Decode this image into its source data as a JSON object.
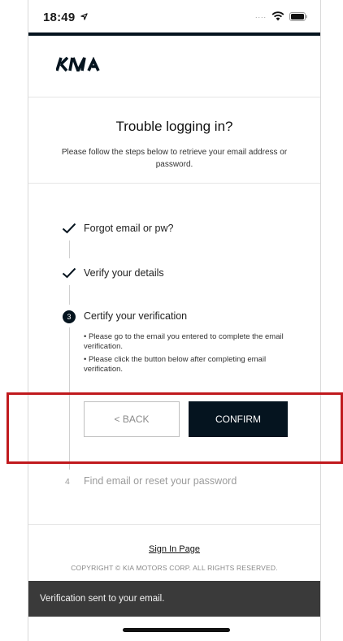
{
  "status_bar": {
    "time": "18:49",
    "location_icon": "location-arrow-icon",
    "signal": "....",
    "wifi_icon": "wifi-icon",
    "battery_icon": "battery-icon"
  },
  "brand": {
    "logo": "KIA",
    "primary_color": "#05141f"
  },
  "page": {
    "title": "Trouble logging in?",
    "subtitle": "Please follow the steps below to retrieve your email address or password."
  },
  "steps": [
    {
      "label": "Forgot email or pw?",
      "state": "done",
      "icon": "check-icon"
    },
    {
      "label": "Verify your details",
      "state": "done",
      "icon": "check-icon"
    },
    {
      "number": "3",
      "label": "Certify your verification",
      "state": "active"
    },
    {
      "number": "4",
      "label": "Find email or reset your password",
      "state": "pending"
    }
  ],
  "notes": [
    "• Please go to the email you entered to complete the email verification.",
    "• Please click the button below after completing email verification."
  ],
  "buttons": {
    "back_label": "< BACK",
    "confirm_label": "CONFIRM"
  },
  "footer": {
    "signin_link": "Sign In Page",
    "copyright": "COPYRIGHT © KIA MOTORS CORP. ALL RIGHTS RESERVED."
  },
  "toast": {
    "message": "Verification sent to your email."
  },
  "annotation": {
    "highlight_color": "#c0191d"
  }
}
